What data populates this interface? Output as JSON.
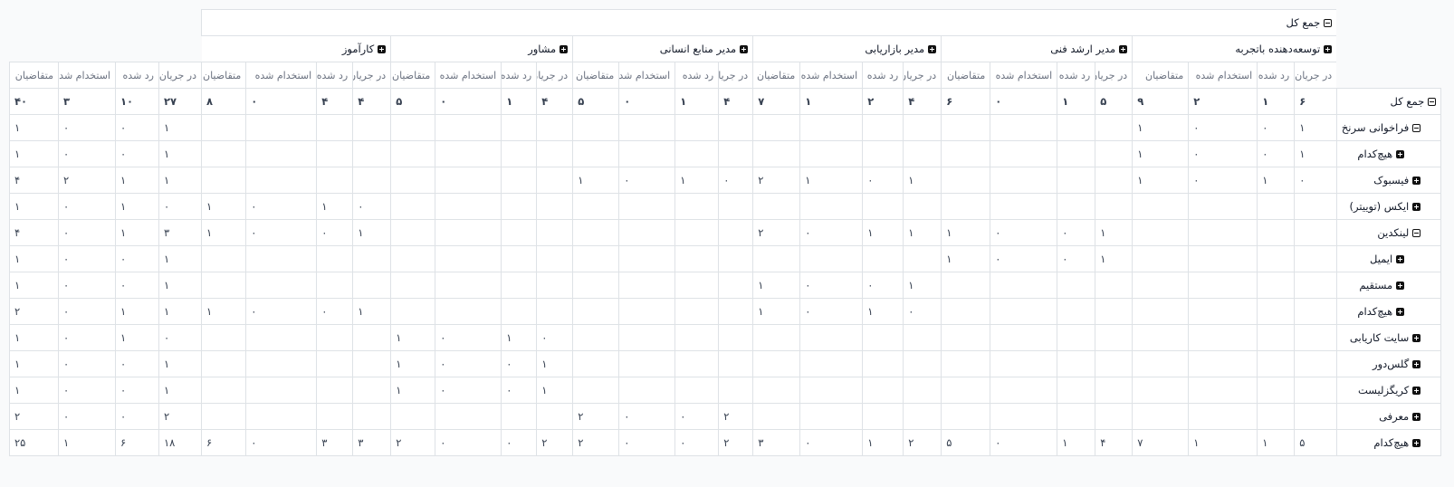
{
  "measures": [
    "در جریان",
    "رد شده",
    "استخدام شده",
    "متقاضیان"
  ],
  "col_total": "جمع کل",
  "columns": [
    {
      "name": "توسعه‌دهنده باتجربه",
      "icon": "plus"
    },
    {
      "name": "مدیر ارشد فنی",
      "icon": "plus"
    },
    {
      "name": "مدیر بازاریابی",
      "icon": "plus"
    },
    {
      "name": "مدیر منابع انسانی",
      "icon": "plus"
    },
    {
      "name": "مشاور",
      "icon": "plus"
    },
    {
      "name": "کارآموز",
      "icon": "plus"
    }
  ],
  "rows": [
    {
      "label": "جمع کل",
      "level": 1,
      "icon": "minus",
      "cells": [
        [
          "۶",
          "۱",
          "۲",
          "۹"
        ],
        [
          "۵",
          "۱",
          "۰",
          "۶"
        ],
        [
          "۴",
          "۲",
          "۱",
          "۷"
        ],
        [
          "۴",
          "۱",
          "۰",
          "۵"
        ],
        [
          "۴",
          "۱",
          "۰",
          "۵"
        ],
        [
          "۴",
          "۴",
          "۰",
          "۸"
        ]
      ],
      "total": [
        "۲۷",
        "۱۰",
        "۳",
        "۴۰"
      ]
    },
    {
      "label": "فراخوانی سرنخ",
      "level": 2,
      "icon": "minus",
      "cells": [
        [
          "۱",
          "۰",
          "۰",
          "۱"
        ],
        [],
        [],
        [],
        [],
        []
      ],
      "total": [
        "۱",
        "۰",
        "۰",
        "۱"
      ]
    },
    {
      "label": "هیچ‌کدام",
      "level": 3,
      "icon": "plus",
      "cells": [
        [
          "۱",
          "۰",
          "۰",
          "۱"
        ],
        [],
        [],
        [],
        [],
        []
      ],
      "total": [
        "۱",
        "۰",
        "۰",
        "۱"
      ]
    },
    {
      "label": "فیسبوک",
      "level": 2,
      "icon": "plus",
      "cells": [
        [
          "۰",
          "۱",
          "۰",
          "۱"
        ],
        [],
        [
          "۱",
          "۰",
          "۱",
          "۲"
        ],
        [
          "۰",
          "۱",
          "۰",
          "۱"
        ],
        [],
        []
      ],
      "total": [
        "۱",
        "۱",
        "۲",
        "۴"
      ]
    },
    {
      "label": "ایکس (توییتر)",
      "level": 2,
      "icon": "plus",
      "cells": [
        [],
        [],
        [],
        [],
        [],
        [
          "۰",
          "۱",
          "۰",
          "۱"
        ]
      ],
      "total": [
        "۰",
        "۱",
        "۰",
        "۱"
      ]
    },
    {
      "label": "لینکدین",
      "level": 2,
      "icon": "minus",
      "cells": [
        [],
        [
          "۱",
          "۰",
          "۰",
          "۱"
        ],
        [
          "۱",
          "۱",
          "۰",
          "۲"
        ],
        [],
        [],
        [
          "۱",
          "۰",
          "۰",
          "۱"
        ]
      ],
      "total": [
        "۳",
        "۱",
        "۰",
        "۴"
      ]
    },
    {
      "label": "ایمیل",
      "level": 3,
      "icon": "plus",
      "cells": [
        [],
        [
          "۱",
          "۰",
          "۰",
          "۱"
        ],
        [],
        [],
        [],
        []
      ],
      "total": [
        "۱",
        "۰",
        "۰",
        "۱"
      ]
    },
    {
      "label": "مستقیم",
      "level": 3,
      "icon": "plus",
      "cells": [
        [],
        [],
        [
          "۱",
          "۰",
          "۰",
          "۱"
        ],
        [],
        [],
        []
      ],
      "total": [
        "۱",
        "۰",
        "۰",
        "۱"
      ]
    },
    {
      "label": "هیچ‌کدام",
      "level": 3,
      "icon": "plus",
      "cells": [
        [],
        [],
        [
          "۰",
          "۱",
          "۰",
          "۱"
        ],
        [],
        [],
        [
          "۱",
          "۰",
          "۰",
          "۱"
        ]
      ],
      "total": [
        "۱",
        "۱",
        "۰",
        "۲"
      ]
    },
    {
      "label": "سایت کاریابی",
      "level": 2,
      "icon": "plus",
      "cells": [
        [],
        [],
        [],
        [],
        [
          "۰",
          "۱",
          "۰",
          "۱"
        ],
        []
      ],
      "total": [
        "۰",
        "۱",
        "۰",
        "۱"
      ]
    },
    {
      "label": "گلس‌دور",
      "level": 2,
      "icon": "plus",
      "cells": [
        [],
        [],
        [],
        [],
        [
          "۱",
          "۰",
          "۰",
          "۱"
        ],
        []
      ],
      "total": [
        "۱",
        "۰",
        "۰",
        "۱"
      ]
    },
    {
      "label": "کریگزلیست",
      "level": 2,
      "icon": "plus",
      "cells": [
        [],
        [],
        [],
        [],
        [
          "۱",
          "۰",
          "۰",
          "۱"
        ],
        []
      ],
      "total": [
        "۱",
        "۰",
        "۰",
        "۱"
      ]
    },
    {
      "label": "معرفی",
      "level": 2,
      "icon": "plus",
      "cells": [
        [],
        [],
        [],
        [
          "۲",
          "۰",
          "۰",
          "۲"
        ],
        [],
        []
      ],
      "total": [
        "۲",
        "۰",
        "۰",
        "۲"
      ]
    },
    {
      "label": "هیچ‌کدام",
      "level": 2,
      "icon": "plus",
      "cells": [
        [
          "۵",
          "۱",
          "۱",
          "۷"
        ],
        [
          "۴",
          "۱",
          "۰",
          "۵"
        ],
        [
          "۲",
          "۱",
          "۰",
          "۳"
        ],
        [
          "۲",
          "۰",
          "۰",
          "۲"
        ],
        [
          "۲",
          "۰",
          "۰",
          "۲"
        ],
        [
          "۳",
          "۳",
          "۰",
          "۶"
        ]
      ],
      "total": [
        "۱۸",
        "۶",
        "۱",
        "۲۵"
      ]
    }
  ]
}
